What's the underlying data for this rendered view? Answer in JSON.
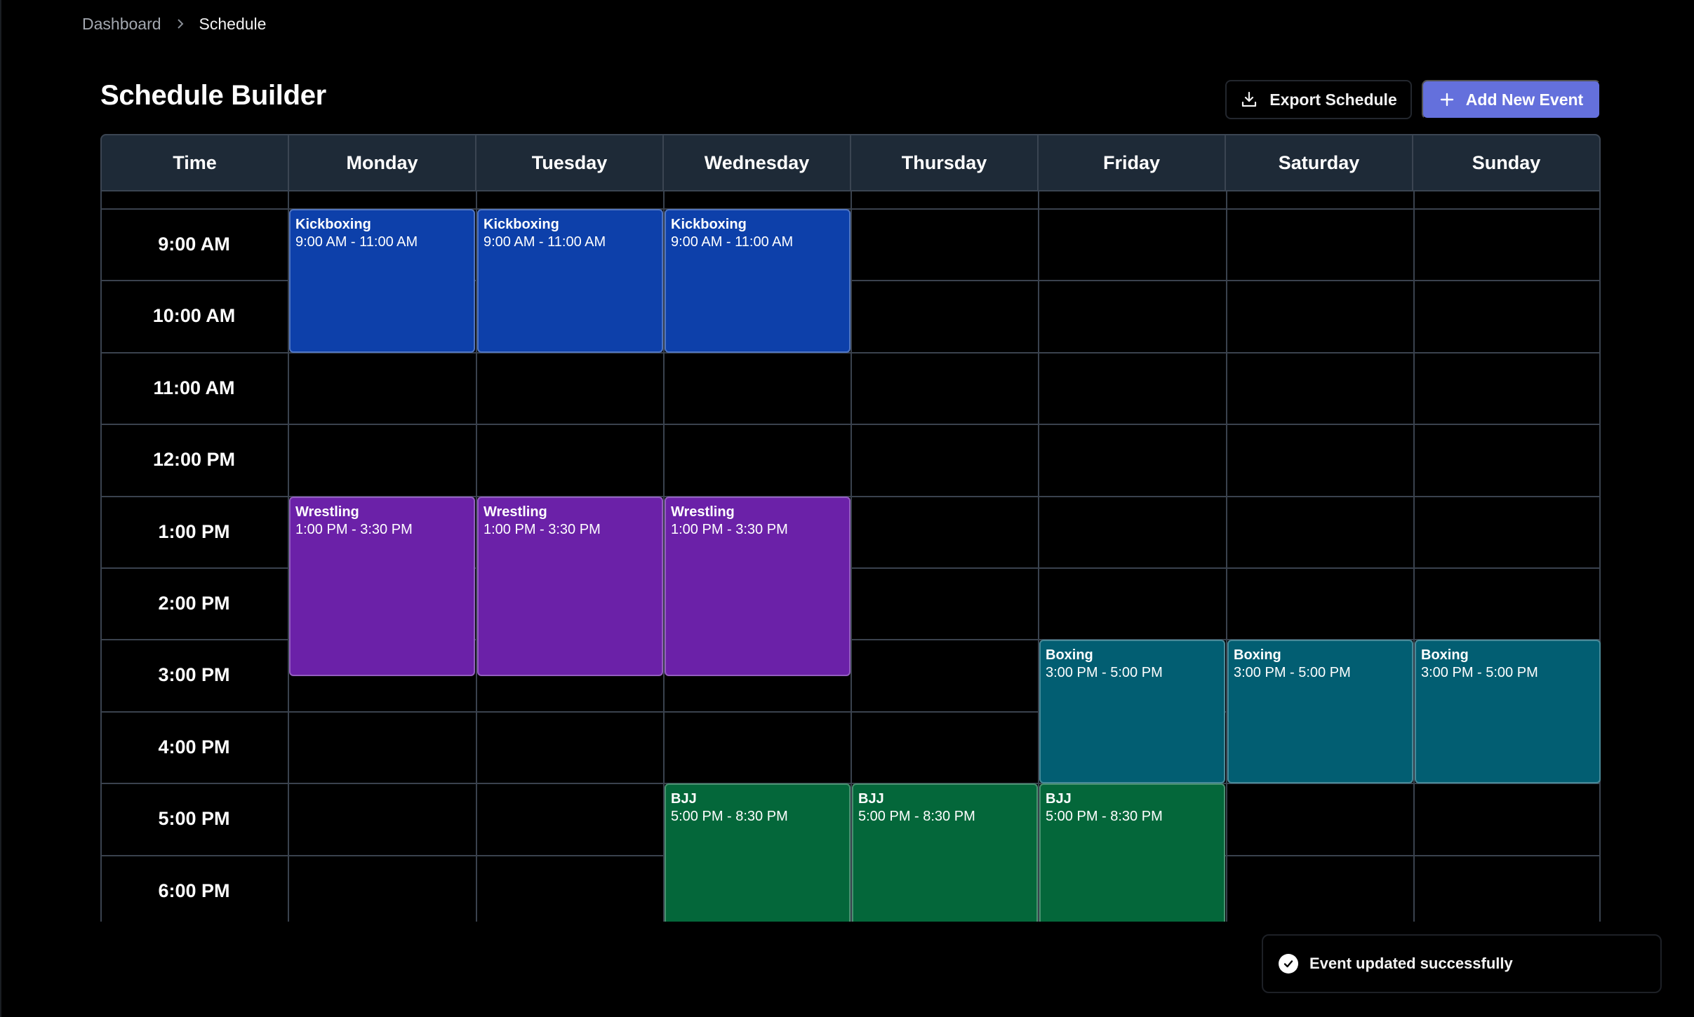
{
  "breadcrumb": {
    "parent": "Dashboard",
    "current": "Schedule"
  },
  "page": {
    "title": "Schedule Builder"
  },
  "toolbar": {
    "export_label": "Export Schedule",
    "add_label": "Add New Event"
  },
  "calendar": {
    "columns": [
      "Time",
      "Monday",
      "Tuesday",
      "Wednesday",
      "Thursday",
      "Friday",
      "Saturday",
      "Sunday"
    ],
    "times": [
      "9:00 AM",
      "10:00 AM",
      "11:00 AM",
      "12:00 PM",
      "1:00 PM",
      "2:00 PM",
      "3:00 PM",
      "4:00 PM",
      "5:00 PM",
      "6:00 PM"
    ],
    "events": [
      {
        "title": "Kickboxing",
        "time": "9:00 AM - 11:00 AM",
        "day": 1,
        "start": 9,
        "end": 11,
        "color": "#0d40aa"
      },
      {
        "title": "Kickboxing",
        "time": "9:00 AM - 11:00 AM",
        "day": 2,
        "start": 9,
        "end": 11,
        "color": "#0d40aa"
      },
      {
        "title": "Kickboxing",
        "time": "9:00 AM - 11:00 AM",
        "day": 3,
        "start": 9,
        "end": 11,
        "color": "#0d40aa"
      },
      {
        "title": "Wrestling",
        "time": "1:00 PM - 3:30 PM",
        "day": 1,
        "start": 13,
        "end": 15.5,
        "color": "#6b21a8"
      },
      {
        "title": "Wrestling",
        "time": "1:00 PM - 3:30 PM",
        "day": 2,
        "start": 13,
        "end": 15.5,
        "color": "#6b21a8"
      },
      {
        "title": "Wrestling",
        "time": "1:00 PM - 3:30 PM",
        "day": 3,
        "start": 13,
        "end": 15.5,
        "color": "#6b21a8"
      },
      {
        "title": "Boxing",
        "time": "3:00 PM - 5:00 PM",
        "day": 5,
        "start": 15,
        "end": 17,
        "color": "#025e72"
      },
      {
        "title": "Boxing",
        "time": "3:00 PM - 5:00 PM",
        "day": 6,
        "start": 15,
        "end": 17,
        "color": "#025e72"
      },
      {
        "title": "Boxing",
        "time": "3:00 PM - 5:00 PM",
        "day": 7,
        "start": 15,
        "end": 17,
        "color": "#025e72"
      },
      {
        "title": "BJJ",
        "time": "5:00 PM - 8:30 PM",
        "day": 3,
        "start": 17,
        "end": 20.5,
        "color": "#04673a"
      },
      {
        "title": "BJJ",
        "time": "5:00 PM - 8:30 PM",
        "day": 4,
        "start": 17,
        "end": 20.5,
        "color": "#04673a"
      },
      {
        "title": "BJJ",
        "time": "5:00 PM - 8:30 PM",
        "day": 5,
        "start": 17,
        "end": 20.5,
        "color": "#04673a"
      }
    ]
  },
  "toast": {
    "message": "Event updated successfully",
    "icon": "check-circle-icon"
  }
}
